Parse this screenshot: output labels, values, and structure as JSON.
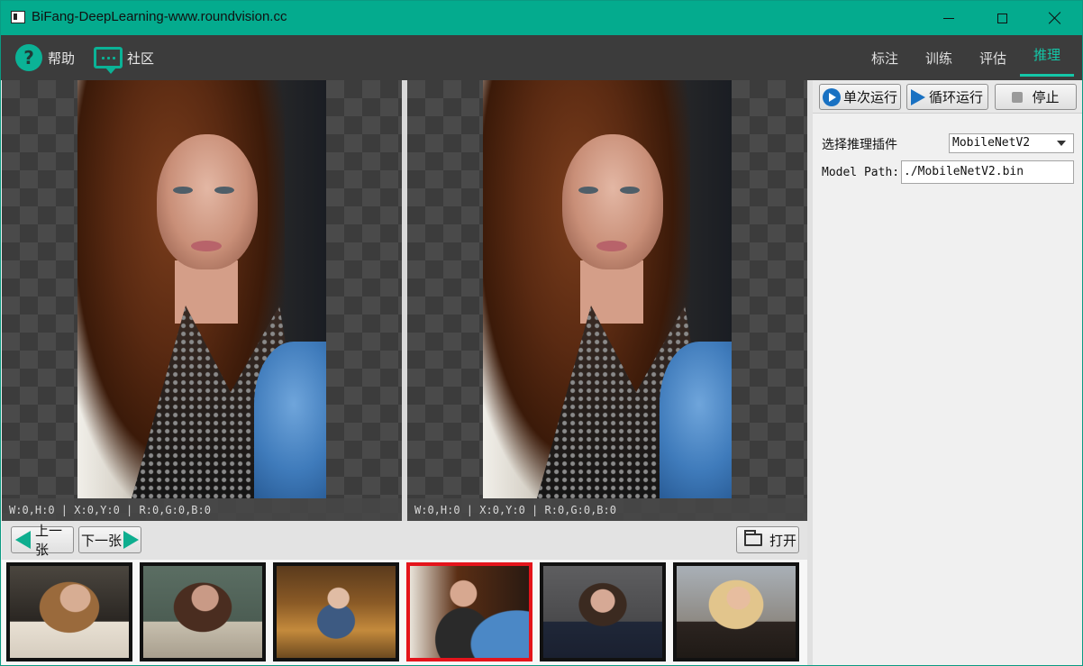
{
  "window": {
    "title": "BiFang-DeepLearning-www.roundvision.cc",
    "controls": [
      "minimize",
      "maximize",
      "close"
    ]
  },
  "menu": {
    "help_label": "帮助",
    "community_label": "社区",
    "tabs": [
      {
        "label": "标注",
        "active": false
      },
      {
        "label": "训练",
        "active": false
      },
      {
        "label": "评估",
        "active": false
      },
      {
        "label": "推理",
        "active": true
      }
    ],
    "accent_color": "#14c7a8"
  },
  "viewers": {
    "left_status": "W:0,H:0 | X:0,Y:0 | R:0,G:0,B:0",
    "right_status": "W:0,H:0 | X:0,Y:0 | R:0,G:0,B:0"
  },
  "navigation": {
    "prev_label": "上一张",
    "next_label": "下一张",
    "open_label": "打开"
  },
  "thumbnails": {
    "count": 6,
    "selected_index": 4,
    "selected_color": "#e4141b"
  },
  "inference_panel": {
    "run_once_label": "单次运行",
    "run_loop_label": "循环运行",
    "stop_label": "停止",
    "plugin_label": "选择推理插件",
    "plugin_value": "MobileNetV2",
    "model_path_label": "Model Path:",
    "model_path_value": "./MobileNetV2.bin"
  }
}
